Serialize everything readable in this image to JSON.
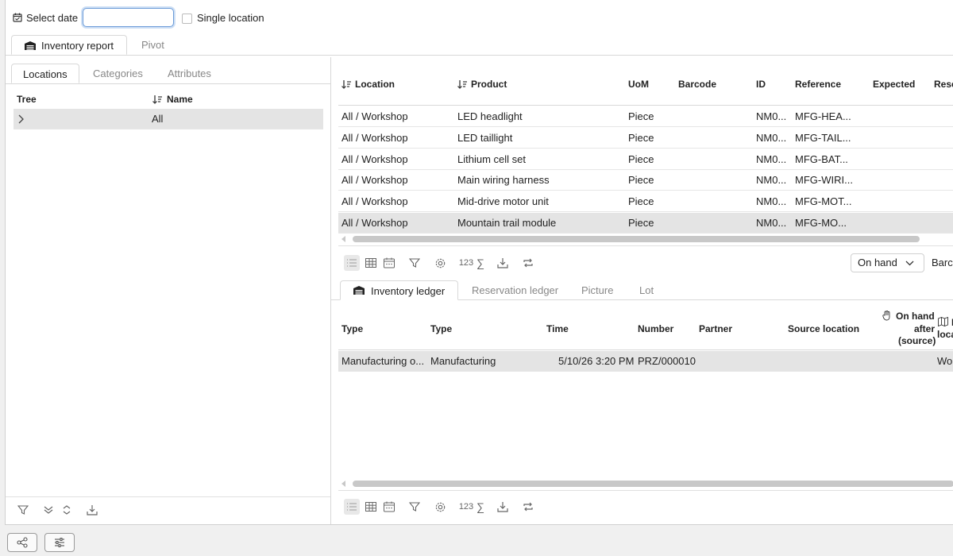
{
  "topbar": {
    "select_date_label": "Select date",
    "date_value": "",
    "single_location_label": "Single location"
  },
  "main_tabs": [
    {
      "label": "Inventory report",
      "active": true
    },
    {
      "label": "Pivot",
      "active": false
    }
  ],
  "left": {
    "tabs": [
      {
        "label": "Locations",
        "active": true
      },
      {
        "label": "Categories",
        "active": false
      },
      {
        "label": "Attributes",
        "active": false
      }
    ],
    "tree_header": "Tree",
    "name_header": "Name",
    "rows": [
      {
        "name": "All"
      }
    ]
  },
  "report": {
    "headers": {
      "location": "Location",
      "product": "Product",
      "uom": "UoM",
      "barcode": "Barcode",
      "id": "ID",
      "reference": "Reference",
      "expected": "Expected",
      "reserved": "Rese"
    },
    "rows": [
      {
        "location": "All / Workshop",
        "product": "LED headlight",
        "uom": "Piece",
        "id": "NM0...",
        "reference": "MFG-HEA..."
      },
      {
        "location": "All / Workshop",
        "product": "LED taillight",
        "uom": "Piece",
        "id": "NM0...",
        "reference": "MFG-TAIL..."
      },
      {
        "location": "All / Workshop",
        "product": "Lithium cell set",
        "uom": "Piece",
        "id": "NM0...",
        "reference": "MFG-BAT..."
      },
      {
        "location": "All / Workshop",
        "product": "Main wiring harness",
        "uom": "Piece",
        "id": "NM0...",
        "reference": "MFG-WIRI..."
      },
      {
        "location": "All / Workshop",
        "product": "Mid-drive motor unit",
        "uom": "Piece",
        "id": "NM0...",
        "reference": "MFG-MOT..."
      },
      {
        "location": "All / Workshop",
        "product": "Mountain trail module",
        "uom": "Piece",
        "id": "NM0...",
        "reference": "MFG-MO..."
      }
    ],
    "toolbar": {
      "number_label": "123",
      "sum_label": "∑",
      "measure_select": "On hand",
      "barcode_label": "Barco"
    }
  },
  "ledger": {
    "tabs": [
      {
        "label": "Inventory ledger",
        "active": true
      },
      {
        "label": "Reservation ledger",
        "active": false
      },
      {
        "label": "Picture",
        "active": false
      },
      {
        "label": "Lot",
        "active": false
      }
    ],
    "headers": {
      "type1": "Type",
      "type2": "Type",
      "time": "Time",
      "number": "Number",
      "partner": "Partner",
      "source_location": "Source location",
      "on_hand_1": "On hand",
      "on_hand_2": "after",
      "on_hand_3": "(source)",
      "dest_1": "I",
      "dest_2": "loca"
    },
    "rows": [
      {
        "type1": "Manufacturing o...",
        "type2": "Manufacturing",
        "time": "5/10/26 3:20 PM",
        "number": "PRZ/000010",
        "dest": "Wo"
      }
    ],
    "toolbar": {
      "number_label": "123",
      "sum_label": "∑"
    }
  }
}
